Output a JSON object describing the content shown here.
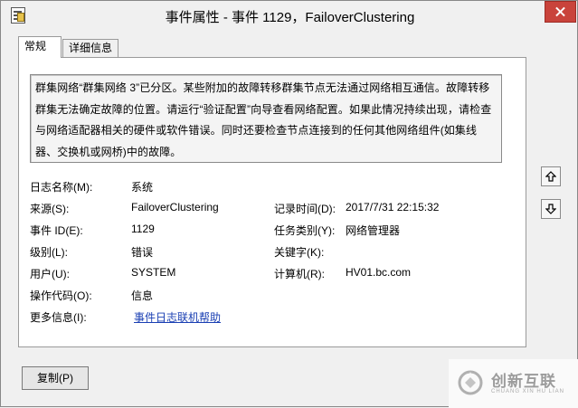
{
  "window": {
    "title": "事件属性 - 事件 1129，FailoverClustering"
  },
  "tabs": [
    {
      "label": "常规",
      "active": true
    },
    {
      "label": "详细信息",
      "active": false
    }
  ],
  "description": "群集网络“群集网络 3”已分区。某些附加的故障转移群集节点无法通过网络相互通信。故障转移群集无法确定故障的位置。请运行“验证配置”向导查看网络配置。如果此情况持续出现，请检查与网络适配器相关的硬件或软件错误。同时还要检查节点连接到的任何其他网络组件(如集线器、交换机或网桥)中的故障。",
  "fields": {
    "log_name": {
      "label": "日志名称(M):",
      "value": "系统"
    },
    "source": {
      "label": "来源(S):",
      "value": "FailoverClustering"
    },
    "logged": {
      "label": "记录时间(D):",
      "value": "2017/7/31 22:15:32"
    },
    "event_id": {
      "label": "事件 ID(E):",
      "value": "1129"
    },
    "task_category": {
      "label": "任务类别(Y):",
      "value": "网络管理器"
    },
    "level": {
      "label": "级别(L):",
      "value": "错误"
    },
    "keywords": {
      "label": "关键字(K):",
      "value": ""
    },
    "user": {
      "label": "用户(U):",
      "value": "SYSTEM"
    },
    "computer": {
      "label": "计算机(R):",
      "value": "HV01.bc.com"
    },
    "opcode": {
      "label": "操作代码(O):",
      "value": "信息"
    },
    "more_info": {
      "label": "更多信息(I):",
      "value": "事件日志联机帮助"
    }
  },
  "buttons": {
    "copy": "复制(P)"
  },
  "icons": {
    "app": "event-properties-icon",
    "close": "close-icon",
    "up": "arrow-up-icon",
    "down": "arrow-down-icon"
  },
  "watermark": {
    "cn": "创新互联",
    "en": "CHUANG XIN HU LIAN"
  },
  "colors": {
    "close_button": "#c9433b",
    "link": "#1a3fb3"
  }
}
